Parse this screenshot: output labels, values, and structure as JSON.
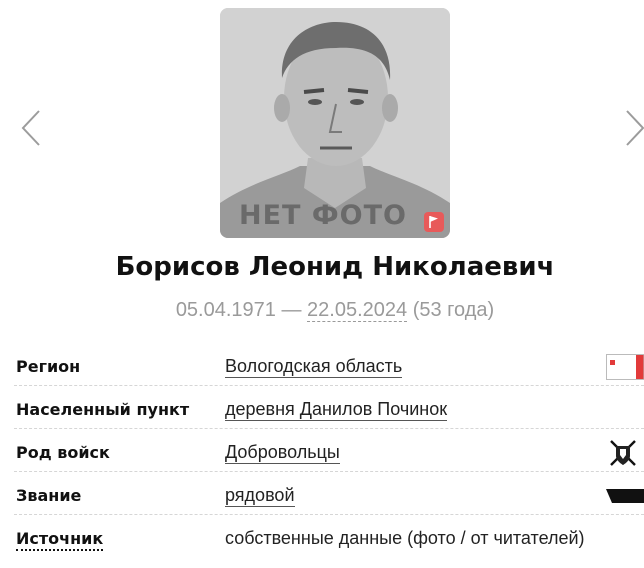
{
  "gallery": {
    "prev_icon": "chevron-left-icon",
    "next_icon": "chevron-right-icon"
  },
  "photo": {
    "placeholder_text": "НЕТ ФОТО",
    "report_icon": "flag-icon",
    "report_color": "#e85a5a"
  },
  "person": {
    "name": "Борисов Леонид Николаевич",
    "birth_date": "05.04.1971",
    "dash": "—",
    "death_date": "22.05.2024",
    "age": "(53 года)"
  },
  "details": {
    "rows": [
      {
        "label": "Регион",
        "value": "Вологодская область",
        "icon": "vologda-flag-icon"
      },
      {
        "label": "Населенный пункт",
        "value": "деревня Данилов Починок"
      },
      {
        "label": "Род войск",
        "value": "Добровольцы",
        "icon": "volunteers-emblem-icon"
      },
      {
        "label": "Звание",
        "value": "рядовой",
        "icon": "rank-insignia-icon"
      },
      {
        "label": "Источник",
        "value": "собственные данные (фото / от читателей)"
      }
    ]
  },
  "colors": {
    "muted_text": "#9a9a9a",
    "divider": "#d6d6d6",
    "flag_red": "#e23a3a"
  }
}
